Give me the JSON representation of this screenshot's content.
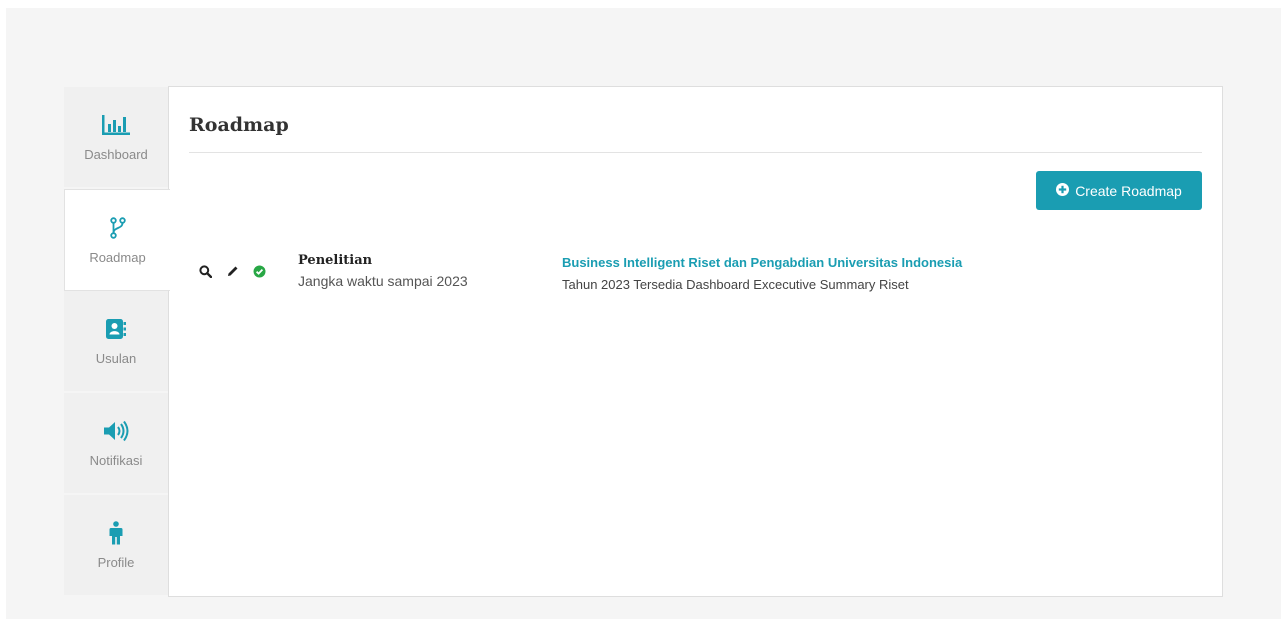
{
  "sidebar": {
    "items": [
      {
        "label": "Dashboard",
        "icon": "bar-chart-icon"
      },
      {
        "label": "Roadmap",
        "icon": "code-branch-icon"
      },
      {
        "label": "Usulan",
        "icon": "address-book-icon"
      },
      {
        "label": "Notifikasi",
        "icon": "volume-up-icon"
      },
      {
        "label": "Profile",
        "icon": "male-icon"
      }
    ],
    "active": "Roadmap",
    "icon_color": "#1a9db2"
  },
  "main": {
    "title": "Roadmap",
    "create_button_label": "Create Roadmap",
    "accent_color": "#1a9db2"
  },
  "roadmaps": [
    {
      "type": "Penelitian",
      "term": "Jangka waktu sampai 2023",
      "title": "Business Intelligent Riset dan Pengabdian Universitas Indonesia",
      "description": "Tahun 2023 Tersedia Dashboard Excecutive Summary Riset",
      "actions": [
        "search-icon",
        "pencil-icon",
        "check-circle-icon"
      ]
    }
  ]
}
